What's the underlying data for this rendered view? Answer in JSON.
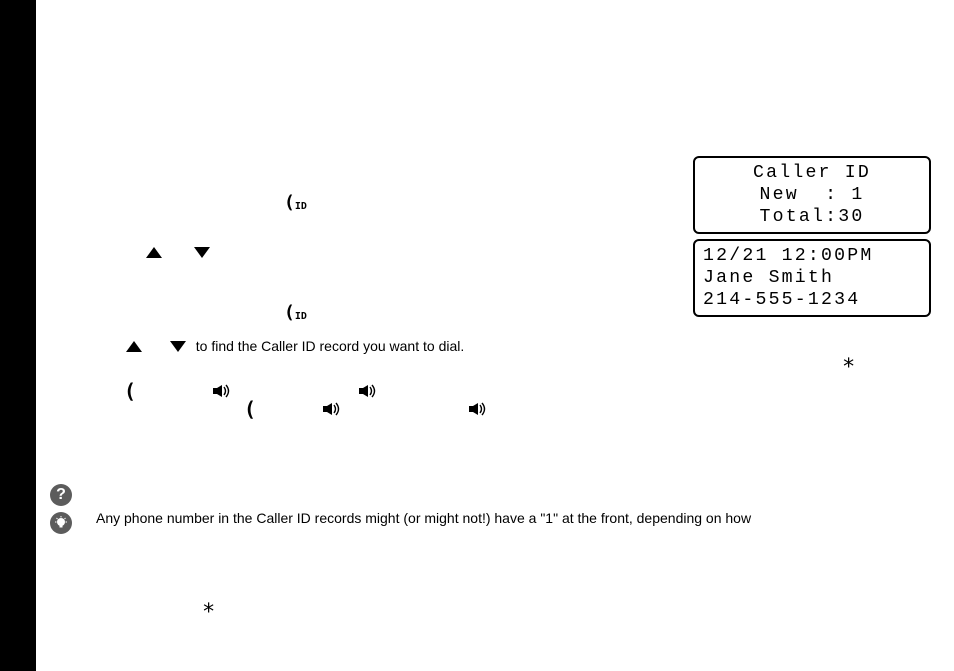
{
  "lcd": {
    "box1": {
      "line1": "Caller ID",
      "line2": "New  : 1",
      "line3": "Total:30"
    },
    "box2": {
      "line1": "12/21 12:00PM",
      "line2": "Jane Smith",
      "line3": "214-555-1234"
    }
  },
  "body": {
    "scroll_suffix": "to find the Caller ID record you want to dial."
  },
  "help": {
    "text": "Any phone number in the Caller ID records might (or might not!) have a \"1\" at the front, depending on how"
  },
  "stars": {
    "s1": "*",
    "s2": "*"
  }
}
